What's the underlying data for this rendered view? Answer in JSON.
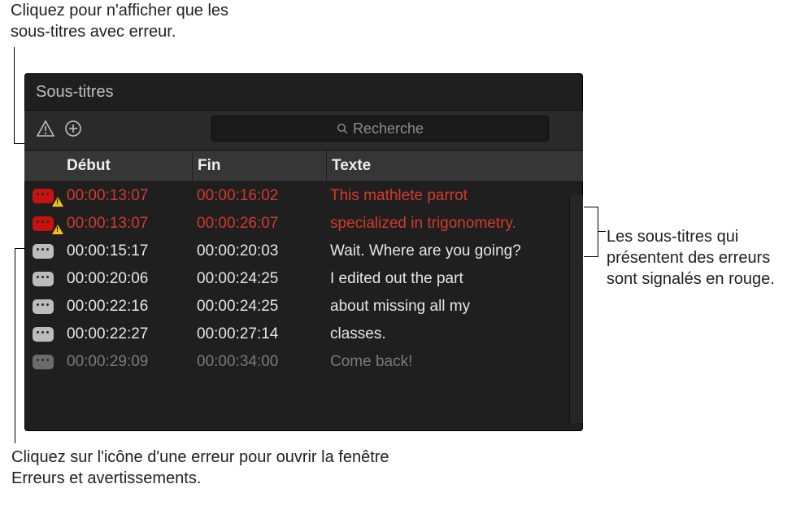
{
  "annotations": {
    "top": "Cliquez pour n'afficher que les sous-titres avec erreur.",
    "right": "Les sous-titres qui présentent des erreurs sont signalés en rouge.",
    "bottom": "Cliquez sur l'icône d'une erreur pour ouvrir la fenêtre Erreurs et avertissements."
  },
  "panel": {
    "title": "Sous-titres",
    "search_placeholder": "Recherche",
    "columns": {
      "start": "Début",
      "end": "Fin",
      "text": "Texte"
    },
    "rows": [
      {
        "icon": "error",
        "start": "00:00:13:07",
        "end": "00:00:16:02",
        "text": "This mathlete parrot",
        "state": "error"
      },
      {
        "icon": "error",
        "start": "00:00:13:07",
        "end": "00:00:26:07",
        "text": "specialized in trigonometry.",
        "state": "error"
      },
      {
        "icon": "normal",
        "start": "00:00:15:17",
        "end": "00:00:20:03",
        "text": "Wait. Where are you going?",
        "state": "normal"
      },
      {
        "icon": "normal",
        "start": "00:00:20:06",
        "end": "00:00:24:25",
        "text": "I edited out the part",
        "state": "normal"
      },
      {
        "icon": "normal",
        "start": "00:00:22:16",
        "end": "00:00:24:25",
        "text": "about missing all my",
        "state": "normal"
      },
      {
        "icon": "normal",
        "start": "00:00:22:27",
        "end": "00:00:27:14",
        "text": "classes.",
        "state": "normal"
      },
      {
        "icon": "dim",
        "start": "00:00:29:09",
        "end": "00:00:34:00",
        "text": "Come back!",
        "state": "dim"
      }
    ]
  }
}
